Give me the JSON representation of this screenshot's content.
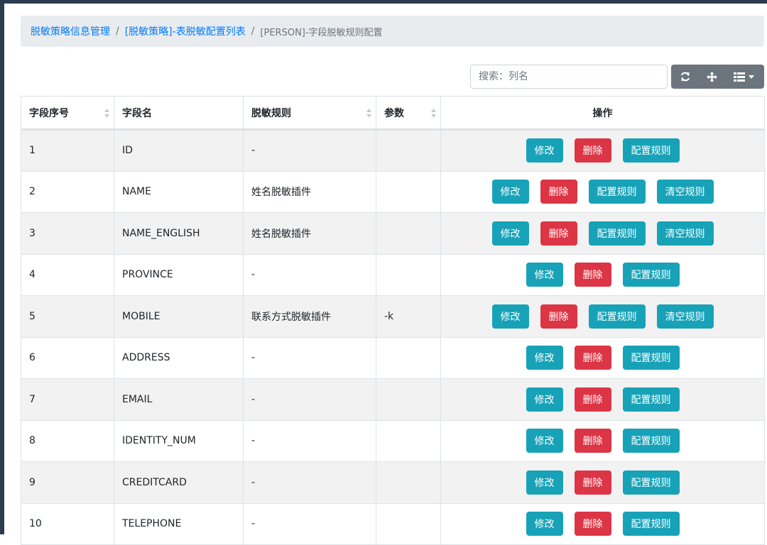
{
  "breadcrumb": {
    "items": [
      "脱敏策略信息管理",
      "[脱敏策略]-表脱敏配置列表"
    ],
    "active": "[PERSON]-字段脱敏规则配置",
    "separator": "/"
  },
  "search": {
    "placeholder": "搜索：列名",
    "value": ""
  },
  "toolbar": {
    "icons": [
      "refresh-icon",
      "move-icon",
      "columns-icon"
    ]
  },
  "table": {
    "headers": [
      "字段序号",
      "字段名",
      "脱敏规则",
      "参数",
      "操作"
    ],
    "action_labels": {
      "edit": "修改",
      "delete": "删除",
      "config": "配置规则",
      "clear": "清空规则"
    },
    "rows": [
      {
        "seq": "1",
        "name": "ID",
        "rule": "-",
        "param": "",
        "has_clear": false
      },
      {
        "seq": "2",
        "name": "NAME",
        "rule": "姓名脱敏插件",
        "param": "",
        "has_clear": true
      },
      {
        "seq": "3",
        "name": "NAME_ENGLISH",
        "rule": "姓名脱敏插件",
        "param": "",
        "has_clear": true
      },
      {
        "seq": "4",
        "name": "PROVINCE",
        "rule": "-",
        "param": "",
        "has_clear": false
      },
      {
        "seq": "5",
        "name": "MOBILE",
        "rule": "联系方式脱敏插件",
        "param": "-k",
        "has_clear": true
      },
      {
        "seq": "6",
        "name": "ADDRESS",
        "rule": "-",
        "param": "",
        "has_clear": false
      },
      {
        "seq": "7",
        "name": "EMAIL",
        "rule": "-",
        "param": "",
        "has_clear": false
      },
      {
        "seq": "8",
        "name": "IDENTITY_NUM",
        "rule": "-",
        "param": "",
        "has_clear": false
      },
      {
        "seq": "9",
        "name": "CREDITCARD",
        "rule": "-",
        "param": "",
        "has_clear": false
      },
      {
        "seq": "10",
        "name": "TELEPHONE",
        "rule": "-",
        "param": "",
        "has_clear": false
      }
    ]
  },
  "colors": {
    "info": "#17a2b8",
    "danger": "#dc3545",
    "link": "#007bff",
    "toolbar": "#6c757d"
  }
}
